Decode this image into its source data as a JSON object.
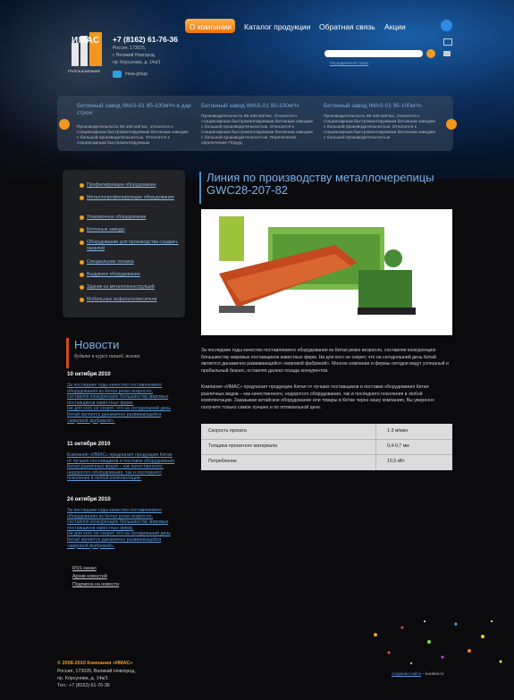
{
  "header": {
    "logo_text": "ИМАС",
    "logo_sub": "ГРУППА КОМПАНИЙ",
    "phone": "+7 (8162) 61-76-36",
    "address": [
      "Россия, 173025,",
      "г. Великий Новгород,",
      "пр. Корсунова, д. 14а/1"
    ],
    "skype": "imas-group",
    "nav": [
      "О компании",
      "Каталог продукции",
      "Обратная связь",
      "Акции"
    ],
    "search_placeholder": "",
    "advanced_search": "Расширенный поиск"
  },
  "slider": [
    {
      "title": "Бетонный завод IMAS-01 95-100м³/ч в дар строи",
      "text": "Производительность 95-100 м3/час, относится к стационарным быстромонтируемым бетонным заводам с большой производительностью. Относится к стационарным быстромонтируемым"
    },
    {
      "title": "Бетонный завод IMAS-01 95-100м³/ч",
      "text": "Производительность 95-100 м3/час, относится к стационарным быстромонтируемым бетонным заводам с большой производительностью. Относится к стационарным быстромонтируемым бетонным заводам с большой производительностью. Перепечение перепечение П(2руд."
    },
    {
      "title": "Бетонный завод IMAS-01 95-100м³/ч",
      "text": "Производительность 95-100 м3/час, относится к стационарным быстромонтируемым бетонным заводам с большой производительностью. Относится к стационарным быстромонтируемым бетонным заводам с большой производительностью"
    }
  ],
  "left_menu": [
    "Профилирующее оборудование",
    "Металлопрофилирующее оборудование",
    "Упаковочное оборудование",
    "Бетонные заводы",
    "Оборудование для производства сэндвич-панелей",
    "Специальная техника",
    "Выдувное оборудование",
    "Здания из металлоконструкций",
    "Мобильные асфальтосмесители"
  ],
  "news": {
    "title": "Новости",
    "subtitle": "будьте в курсе нашей жизни",
    "items": [
      {
        "date": "10 октября 2010",
        "lines": [
          "За последние годы качество поставляемого",
          "оборудования из Китая резко возросло,",
          "составляя конкуренцию большинству мировых",
          "поставщиков известных фирм.",
          "Ни для кого не секрет, что на сегодняшний день",
          "Китай является динамично развивающейся",
          "«мировой фабрикой»."
        ]
      },
      {
        "date": "11 октября 2010",
        "lines": [
          "Компания «ИМАС» предлагает продукцию Китая",
          "от лучших поставщиков и поставки оборудования",
          "Китая различных видов – как качественного,",
          "недорогого оборудования, так и последнего",
          "поколения в любой комплектации."
        ]
      },
      {
        "date": "24 октября 2010",
        "lines": [
          "За последние годы качество поставляемого",
          "оборудования из Китая резко возросло,",
          "составляя конкуренцию большинству мировых",
          "поставщиков известных фирм.",
          "Ни для кого не секрет, что на сегодняшний день",
          "Китай является динамично развивающейся",
          "«мировой фабрикой»."
        ]
      }
    ],
    "links": [
      "RSS канал",
      "Архив новостей",
      "Подписка на новости"
    ]
  },
  "main": {
    "title": "Линия по производству металлочерепицы GWC28-207-82",
    "para1": "За последние годы качество поставляемого оборудования из Китая резко возросло, составляя конкуренцию большинству мировых поставщиков известных фирм. Ни для кого не секрет, что на сегодняшний день Китай является динамично развивающейся «мировой фабрикой». Многие компании и фирмы сегодня ведут успешный и прибыльный бизнес, оставляя далеко позади конкурентов.",
    "para2": "Компания «ИМАС» предлагает продукцию Китая от лучших поставщиков и поставки оборудования Китая различных видов – как качественного, недорогого оборудования, так и последнего поколения в любой комплектации. Заказывая китайское оборудование или товары в Китае через нашу компанию, Вы уверенно получите только самое лучшее и по оптимальной цене.",
    "specs": [
      {
        "label": "Скорость проката",
        "value": "1-3 м/мин"
      },
      {
        "label": "Толщина прокатного материала",
        "value": "0,4-0,7 мм"
      },
      {
        "label": "Потребление",
        "value": "10,5 кВт"
      }
    ]
  },
  "footer": {
    "copyright": "© 2008-2010 Компания «ИМАС»",
    "address": [
      "Россия, 173025, Великий Новгород,",
      "пр. Корсунова, д. 14а/1",
      "Тел.: +7 (8162) 61-76-36"
    ],
    "credits_link": "создание сайта",
    "credits_text": " – kuratov.ru"
  },
  "colors": {
    "accent": "#f2971e",
    "link": "#5d9ad8",
    "title": "#7cb0e4"
  }
}
